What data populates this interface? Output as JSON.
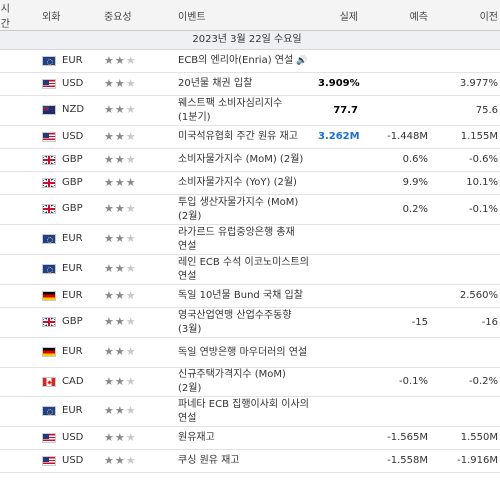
{
  "header": {
    "time": "시간",
    "currency": "외화",
    "importance": "중요성",
    "event": "이벤트",
    "actual": "실제",
    "forecast": "예측",
    "previous": "이전"
  },
  "date_label": "2023년 3월 22일 수요일",
  "star_glyph": "★",
  "speech_glyph": "🔊",
  "rows": [
    {
      "time": "0",
      "flag": "eur",
      "currency": "EUR",
      "stars": 2,
      "event": "ECB의 엔리아(Enria) 연설",
      "speech": true,
      "actual": "",
      "forecast": "",
      "previous": "",
      "h": 1
    },
    {
      "time": "0",
      "flag": "usd",
      "currency": "USD",
      "stars": 2,
      "event": "20년물 채권 입찰",
      "speech": false,
      "actual": "3.909%",
      "actual_style": "bold",
      "forecast": "",
      "previous": "3.977%",
      "h": 1
    },
    {
      "time": "0",
      "flag": "nzd",
      "currency": "NZD",
      "stars": 2,
      "event": "웨스트팩 소비자심리지수 (1분기)",
      "speech": false,
      "actual": "77.7",
      "actual_style": "bold",
      "forecast": "",
      "previous": "75.6",
      "h": 2
    },
    {
      "time": "0",
      "flag": "usd",
      "currency": "USD",
      "stars": 2,
      "event": "미국석유협회 주간 원유 재고",
      "speech": false,
      "actual": "3.262M",
      "actual_style": "blue",
      "forecast": "-1.448M",
      "previous": "1.155M",
      "h": 1
    },
    {
      "time": "0",
      "flag": "gbp",
      "currency": "GBP",
      "stars": 2,
      "event": "소비자물가지수 (MoM) (2월)",
      "speech": false,
      "actual": "",
      "forecast": "0.6%",
      "previous": "-0.6%",
      "h": 1
    },
    {
      "time": "0",
      "flag": "gbp",
      "currency": "GBP",
      "stars": 3,
      "event": "소비자물가지수 (YoY) (2월)",
      "speech": false,
      "actual": "",
      "forecast": "9.9%",
      "previous": "10.1%",
      "h": 1
    },
    {
      "time": "0",
      "flag": "gbp",
      "currency": "GBP",
      "stars": 2,
      "event": "투입 생산자물가지수 (MoM) (2월)",
      "speech": false,
      "actual": "",
      "forecast": "0.2%",
      "previous": "-0.1%",
      "h": 2
    },
    {
      "time": "5",
      "flag": "eur",
      "currency": "EUR",
      "stars": 2,
      "event": "라가르드 유럽중앙은행 총재 연설",
      "speech": false,
      "actual": "",
      "forecast": "",
      "previous": "",
      "h": 2
    },
    {
      "time": "0",
      "flag": "eur",
      "currency": "EUR",
      "stars": 2,
      "event": "레인 ECB 수석 이코노미스트의 연설",
      "speech": false,
      "actual": "",
      "forecast": "",
      "previous": "",
      "h": 2
    },
    {
      "time": "0",
      "flag": "deu",
      "currency": "EUR",
      "stars": 2,
      "event": "독일 10년물 Bund 국채 입찰",
      "speech": false,
      "actual": "",
      "forecast": "",
      "previous": "2.560%",
      "h": 1
    },
    {
      "time": "0",
      "flag": "gbp",
      "currency": "GBP",
      "stars": 2,
      "event": "영국산업연맹 산업수주동향 (3월)",
      "speech": false,
      "actual": "",
      "forecast": "-15",
      "previous": "-16",
      "h": 2
    },
    {
      "time": "5",
      "flag": "deu",
      "currency": "EUR",
      "stars": 2,
      "event": "독일 연방은행 마우더러의 연설",
      "speech": false,
      "actual": "",
      "forecast": "",
      "previous": "",
      "h": 2
    },
    {
      "time": "0",
      "flag": "cad",
      "currency": "CAD",
      "stars": 2,
      "event": "신규주택가격지수 (MoM) (2월)",
      "speech": false,
      "actual": "",
      "forecast": "-0.1%",
      "previous": "-0.2%",
      "h": 1
    },
    {
      "time": "5",
      "flag": "eur",
      "currency": "EUR",
      "stars": 2,
      "event": "파네타 ECB 집행이사회 이사의 연설",
      "speech": false,
      "actual": "",
      "forecast": "",
      "previous": "",
      "h": 2
    },
    {
      "time": "0",
      "flag": "usd",
      "currency": "USD",
      "stars": 2,
      "event": "원유재고",
      "speech": false,
      "actual": "",
      "forecast": "-1.565M",
      "previous": "1.550M",
      "h": 1
    },
    {
      "time": "0",
      "flag": "usd",
      "currency": "USD",
      "stars": 2,
      "event": "쿠싱 원유 재고",
      "speech": false,
      "actual": "",
      "forecast": "-1.558M",
      "previous": "-1.916M",
      "h": 1
    }
  ]
}
